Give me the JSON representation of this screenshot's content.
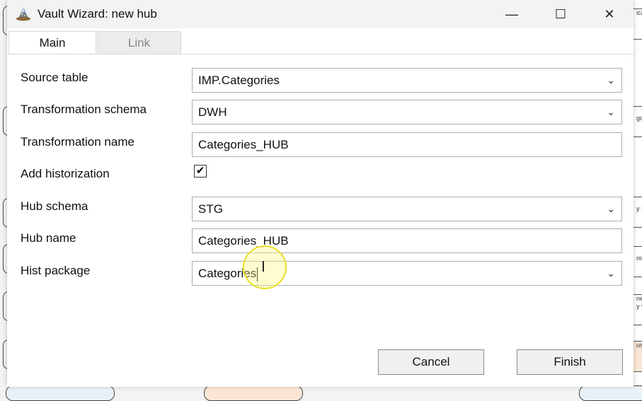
{
  "window": {
    "title": "Vault Wizard: new hub",
    "icon": "wizard-hat-icon",
    "controls": {
      "minimize": "—",
      "maximize": "☐",
      "close": "✕"
    }
  },
  "tabs": [
    {
      "label": "Main",
      "active": true
    },
    {
      "label": "Link",
      "active": false
    }
  ],
  "form": {
    "source_table": {
      "label": "Source table",
      "value": "IMP.Categories"
    },
    "transformation_schema": {
      "label": "Transformation schema",
      "value": "DWH"
    },
    "transformation_name": {
      "label": "Transformation name",
      "value": "Categories_HUB"
    },
    "add_historization": {
      "label": "Add historization",
      "checked": true,
      "mark": "✔"
    },
    "hub_schema": {
      "label": "Hub schema",
      "value": "STG"
    },
    "hub_name": {
      "label": "Hub name",
      "value": "Categories_HUB"
    },
    "hist_package": {
      "label": "Hist package",
      "value": "Categories"
    }
  },
  "buttons": {
    "cancel": "Cancel",
    "finish": "Finish"
  },
  "background_fragments": [
    "ica",
    "go",
    "y S",
    "ro",
    "ne",
    "y v",
    "us"
  ],
  "colors": {
    "highlight": "#e9e02a",
    "border": "#adadad"
  }
}
